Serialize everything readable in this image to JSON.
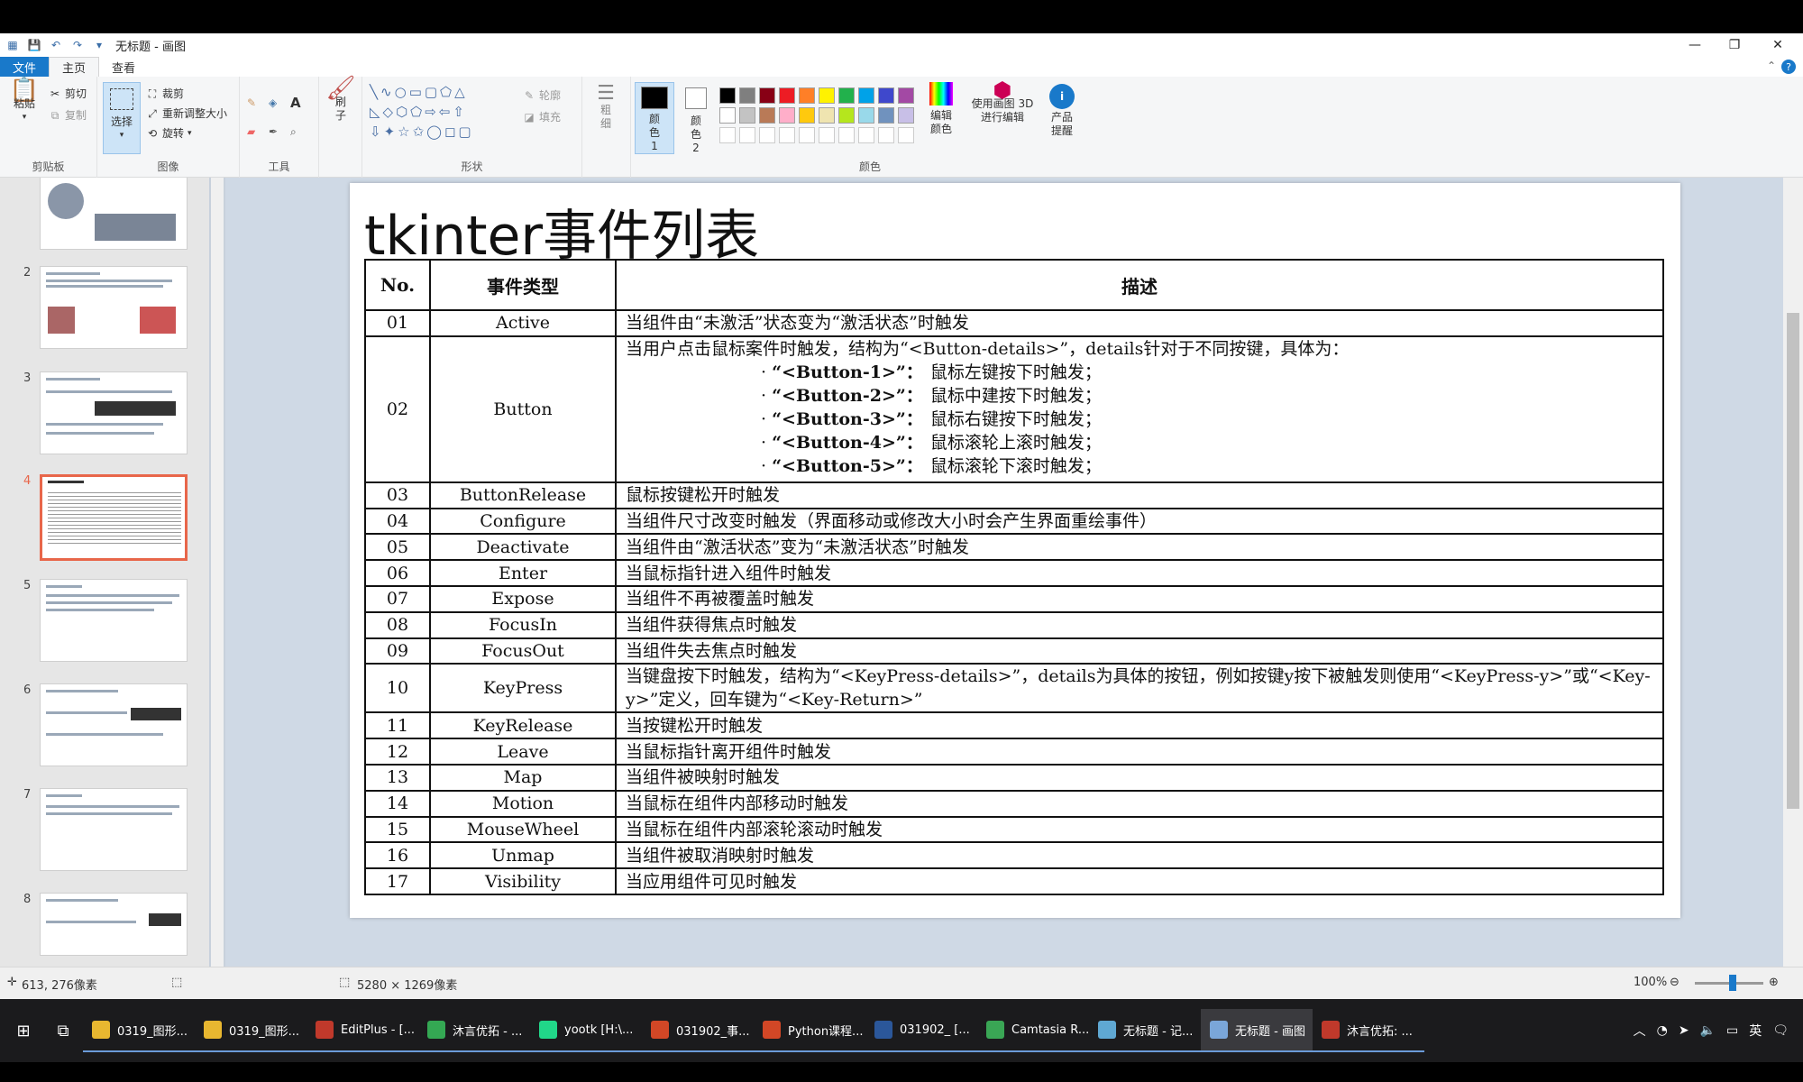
{
  "window": {
    "title": "无标题 - 画图",
    "tabs": [
      "文件",
      "主页",
      "查看"
    ]
  },
  "ribbon": {
    "clipboard": {
      "paste": "粘贴",
      "cut": "剪切",
      "copy": "复制",
      "label": "剪贴板"
    },
    "image": {
      "select": "选择",
      "crop": "裁剪",
      "resize": "重新调整大小",
      "rotate": "旋转",
      "label": "图像"
    },
    "tools": {
      "label": "工具"
    },
    "brush": {
      "label": "刷子"
    },
    "shapes": {
      "outline": "轮廓",
      "fill": "填充",
      "label": "形状"
    },
    "size": {
      "label": "粗细"
    },
    "color1": "颜色 1",
    "color2": "颜色 2",
    "colors": {
      "label": "颜色",
      "edit": "编辑颜色"
    },
    "paint3d": "使用画图 3D 进行编辑",
    "product_alert": "产品提醒",
    "palette": [
      "#000000",
      "#7f7f7f",
      "#880015",
      "#ed1c24",
      "#ff7f27",
      "#fff200",
      "#22b14c",
      "#00a2e8",
      "#3f48cc",
      "#a349a4",
      "#ffffff",
      "#c3c3c3",
      "#b97a57",
      "#ffaec9",
      "#ffc90e",
      "#efe4b0",
      "#b5e61d",
      "#99d9ea",
      "#7092be",
      "#c8bfe7"
    ]
  },
  "slides": {
    "numbers": [
      "2",
      "3",
      "4",
      "5",
      "6",
      "7",
      "8"
    ],
    "selected": "4"
  },
  "slide": {
    "title": "tkinter事件列表",
    "headers": [
      "No.",
      "事件类型",
      "描述"
    ],
    "rows": [
      {
        "no": "01",
        "type": "Active",
        "desc": "当组件由“未激活”状态变为“激活状态”时触发"
      },
      {
        "no": "02",
        "type": "Button",
        "desc": "当用户点击鼠标案件时触发，结构为“<Button-details>”，details针对于不同按键，具体为：",
        "sub": [
          {
            "key": "“<Button-1>”：",
            "text": "鼠标左键按下时触发；"
          },
          {
            "key": "“<Button-2>”：",
            "text": "鼠标中建按下时触发；"
          },
          {
            "key": "“<Button-3>”：",
            "text": "鼠标右键按下时触发；"
          },
          {
            "key": "“<Button-4>”：",
            "text": "鼠标滚轮上滚时触发；"
          },
          {
            "key": "“<Button-5>”：",
            "text": "鼠标滚轮下滚时触发；"
          }
        ]
      },
      {
        "no": "03",
        "type": "ButtonRelease",
        "desc": "鼠标按键松开时触发"
      },
      {
        "no": "04",
        "type": "Configure",
        "desc": "当组件尺寸改变时触发（界面移动或修改大小时会产生界面重绘事件）"
      },
      {
        "no": "05",
        "type": "Deactivate",
        "desc": "当组件由“激活状态”变为“未激活状态”时触发"
      },
      {
        "no": "06",
        "type": "Enter",
        "desc": "当鼠标指针进入组件时触发"
      },
      {
        "no": "07",
        "type": "Expose",
        "desc": "当组件不再被覆盖时触发"
      },
      {
        "no": "08",
        "type": "FocusIn",
        "desc": "当组件获得焦点时触发"
      },
      {
        "no": "09",
        "type": "FocusOut",
        "desc": "当组件失去焦点时触发"
      },
      {
        "no": "10",
        "type": "KeyPress",
        "desc": "当键盘按下时触发，结构为“<KeyPress-details>”，details为具体的按钮，例如按键y按下被触发则使用“<KeyPress-y>”或“<Key-y>”定义，回车键为“<Key-Return>”"
      },
      {
        "no": "11",
        "type": "KeyRelease",
        "desc": "当按键松开时触发"
      },
      {
        "no": "12",
        "type": "Leave",
        "desc": "当鼠标指针离开组件时触发"
      },
      {
        "no": "13",
        "type": "Map",
        "desc": "当组件被映射时触发"
      },
      {
        "no": "14",
        "type": "Motion",
        "desc": "当鼠标在组件内部移动时触发"
      },
      {
        "no": "15",
        "type": "MouseWheel",
        "desc": "当鼠标在组件内部滚轮滚动时触发"
      },
      {
        "no": "16",
        "type": "Unmap",
        "desc": "当组件被取消映射时触发"
      },
      {
        "no": "17",
        "type": "Visibility",
        "desc": "当应用组件可见时触发"
      }
    ]
  },
  "statusbar": {
    "cursor": "613, 276像素",
    "size": "5280 × 1269像素",
    "zoom": "100%"
  },
  "taskbar": {
    "apps": [
      {
        "label": "0319_图形...",
        "color": "#e8b730"
      },
      {
        "label": "0319_图形...",
        "color": "#e8b730"
      },
      {
        "label": "EditPlus - [...",
        "color": "#c0392b"
      },
      {
        "label": "沐言优拓 - ...",
        "color": "#34a853"
      },
      {
        "label": "yootk [H:\\...",
        "color": "#21d789"
      },
      {
        "label": "031902_事...",
        "color": "#d24726"
      },
      {
        "label": "Python课程...",
        "color": "#d24726"
      },
      {
        "label": "031902_ [...",
        "color": "#2b579a"
      },
      {
        "label": "Camtasia R...",
        "color": "#3aa655"
      },
      {
        "label": "无标题 - 记...",
        "color": "#5fa8d3"
      },
      {
        "label": "无标题 - 画图",
        "color": "#7aa6d9"
      },
      {
        "label": "沐言优拓: ...",
        "color": "#c0392b"
      }
    ],
    "ime": "英"
  }
}
